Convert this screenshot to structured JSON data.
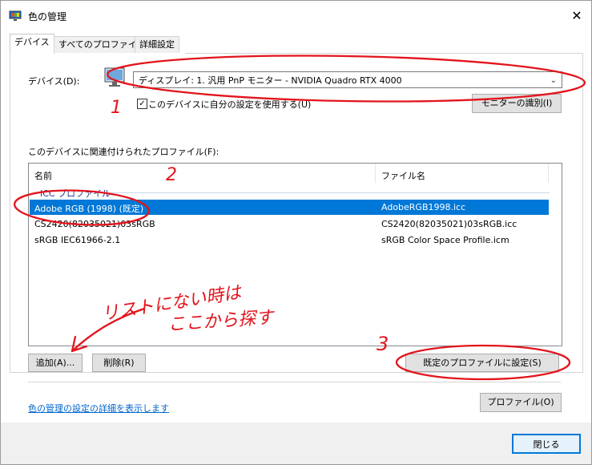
{
  "window": {
    "title": "色の管理",
    "close_glyph": "✕"
  },
  "tabs": [
    {
      "label": "デバイス"
    },
    {
      "label": "すべてのプロファイル"
    },
    {
      "label": "詳細設定"
    }
  ],
  "device": {
    "label": "デバイス(D):",
    "selected": "ディスプレイ: 1. 汎用 PnP モニター - NVIDIA Quadro RTX 4000",
    "use_my_settings_label": "このデバイスに自分の設定を使用する(U)",
    "identify_button": "モニターの識別(I)"
  },
  "profiles": {
    "section_label": "このデバイスに関連付けられたプロファイル(F):",
    "columns": [
      "名前",
      "ファイル名"
    ],
    "group_label": "ICC プロファイル",
    "rows": [
      {
        "name": "Adobe RGB (1998) (既定)",
        "file": "AdobeRGB1998.icc"
      },
      {
        "name": "CS2420(82035021)03sRGB",
        "file": "CS2420(82035021)03sRGB.icc"
      },
      {
        "name": "sRGB IEC61966-2.1",
        "file": "sRGB Color Space Profile.icm"
      }
    ],
    "add_button": "追加(A)...",
    "remove_button": "削除(R)",
    "set_default_button": "既定のプロファイルに設定(S)"
  },
  "footer": {
    "details_link": "色の管理の設定の詳細を表示します",
    "profile_button": "プロファイル(O)",
    "close_button": "閉じる"
  },
  "annotations": {
    "n1": "1",
    "n2": "2",
    "n3": "3",
    "note_line1": "リストにない時は",
    "note_line2": "ここから探す"
  },
  "colors": {
    "selection": "#0078d7",
    "annotation": "#e3141c",
    "link": "#0066cc"
  },
  "icons": [
    "monitor-icon",
    "close-icon",
    "chevron-down-icon",
    "checkbox-checked-icon"
  ]
}
